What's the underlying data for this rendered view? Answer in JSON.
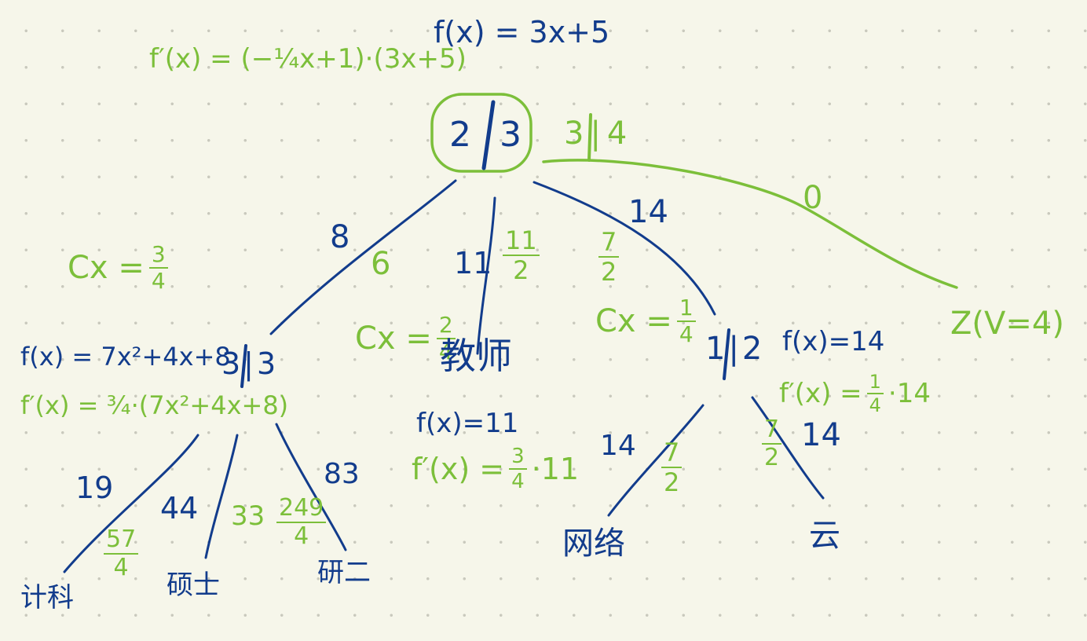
{
  "colors": {
    "blue": "#123c8c",
    "green": "#7cbf3a",
    "background": "#f6f6ea",
    "grid_dot": "#c9c9bd"
  },
  "top": {
    "fprime": "f′(x) = (−¼x+1)·(3x+5)",
    "fx": "f(x) = 3x+5"
  },
  "root": {
    "left": "2",
    "right": "3",
    "annot": "3|4"
  },
  "left_cx": {
    "prefix": "Cx =",
    "num": "3",
    "den": "4"
  },
  "edges": {
    "root_left_blue": "8",
    "root_left_green": "6",
    "root_mid_blue": "11",
    "root_mid_green_num": "11",
    "root_mid_green_den": "2",
    "root_right_blue": "14",
    "root_right_green_num": "7",
    "root_right_green_den": "2",
    "root_far_green": "0"
  },
  "left_node": {
    "label": "3|3",
    "fx": "f(x) = 7x²+4x+8",
    "fprime": "f′(x) = ¾·(7x²+4x+8)",
    "edge_a_blue": "19",
    "edge_a_num": "57",
    "edge_a_den": "4",
    "edge_b_blue": "44",
    "edge_b_green": "33",
    "edge_c_blue": "83",
    "edge_c_num": "249",
    "edge_c_den": "4",
    "leaf_a": "计科",
    "leaf_b": "硕士",
    "leaf_c": "研二"
  },
  "mid_node": {
    "cx_prefix": "Cx =",
    "cx_num": "2",
    "cx_den": "4",
    "label": "教师",
    "fx": "f(x)=11",
    "fprime_prefix": "f′(x) =",
    "fprime_num": "3",
    "fprime_den": "4",
    "fprime_suffix": "·11"
  },
  "right_node": {
    "cx_prefix": "Cx =",
    "cx_num": "1",
    "cx_den": "4",
    "label": "1|2",
    "fx": "f(x)=14",
    "fprime_prefix": "f′(x) =",
    "fprime_num": "1",
    "fprime_den": "4",
    "fprime_suffix": "·14",
    "edge_a_blue": "14",
    "edge_a_num": "7",
    "edge_a_den": "2",
    "edge_b_blue": "14",
    "edge_b_num": "7",
    "edge_b_den": "2",
    "leaf_a": "网络",
    "leaf_b": "云"
  },
  "far_right_node": {
    "label": "Z(V=4)"
  }
}
